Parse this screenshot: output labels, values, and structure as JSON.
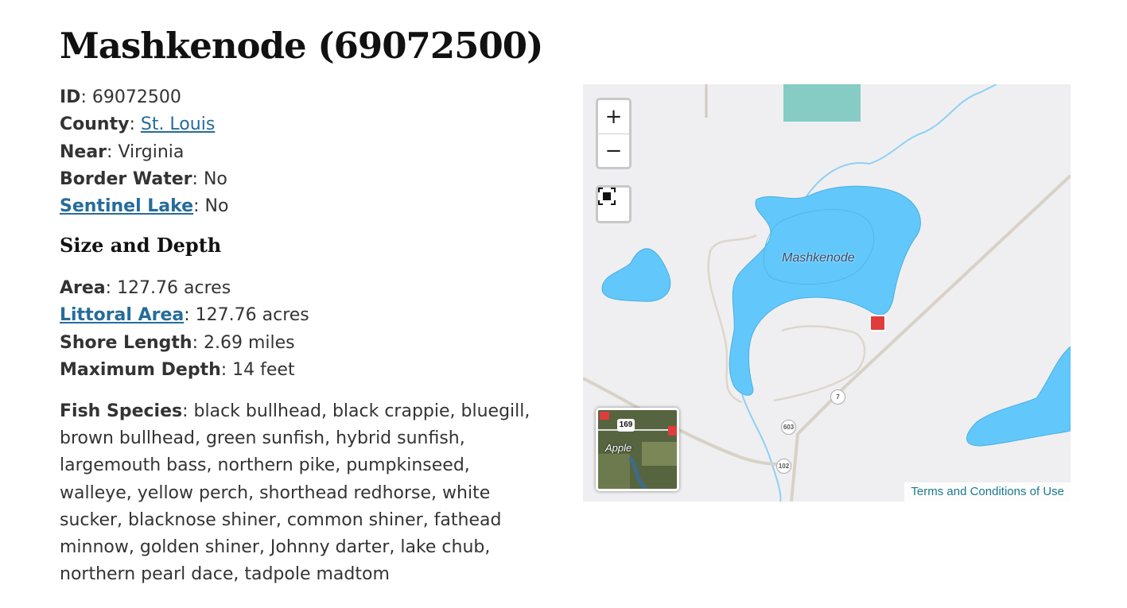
{
  "page": {
    "title": "Mashkenode (69072500)"
  },
  "info": {
    "id_label": "ID",
    "id_value": "69072500",
    "county_label": "County",
    "county_value": "St. Louis",
    "near_label": "Near",
    "near_value": "Virginia",
    "border_label": "Border Water",
    "border_value": "No",
    "sentinel_label": "Sentinel Lake",
    "sentinel_value": "No"
  },
  "size_depth": {
    "heading": "Size and Depth",
    "area_label": "Area",
    "area_value": "127.76 acres",
    "littoral_label": "Littoral Area",
    "littoral_value": "127.76 acres",
    "shore_label": "Shore Length",
    "shore_value": "2.69 miles",
    "depth_label": "Maximum Depth",
    "depth_value": "14 feet"
  },
  "fish": {
    "label": "Fish Species",
    "value": "black bullhead, black crappie, bluegill, brown bullhead, green sunfish, hybrid sunfish, largemouth bass, northern pike, pumpkinseed, walleye, yellow perch, shorthead redhorse, white sucker, blacknose shiner, common shiner, fathead minnow, golden shiner, Johnny darter, lake chub, northern pearl dace, tadpole madtom"
  },
  "map": {
    "zoom_in": "+",
    "zoom_out": "−",
    "lake_label": "Mashkenode",
    "road_7": "7",
    "road_603": "603",
    "road_102": "102",
    "minimap_label": "Apple",
    "minimap_shield": "169",
    "terms": "Terms and Conditions of Use",
    "water_color": "#62c8fb",
    "land_color": "#efeff1",
    "access_icon": "boat-access-icon",
    "fullscreen_icon": "fullscreen-icon"
  }
}
